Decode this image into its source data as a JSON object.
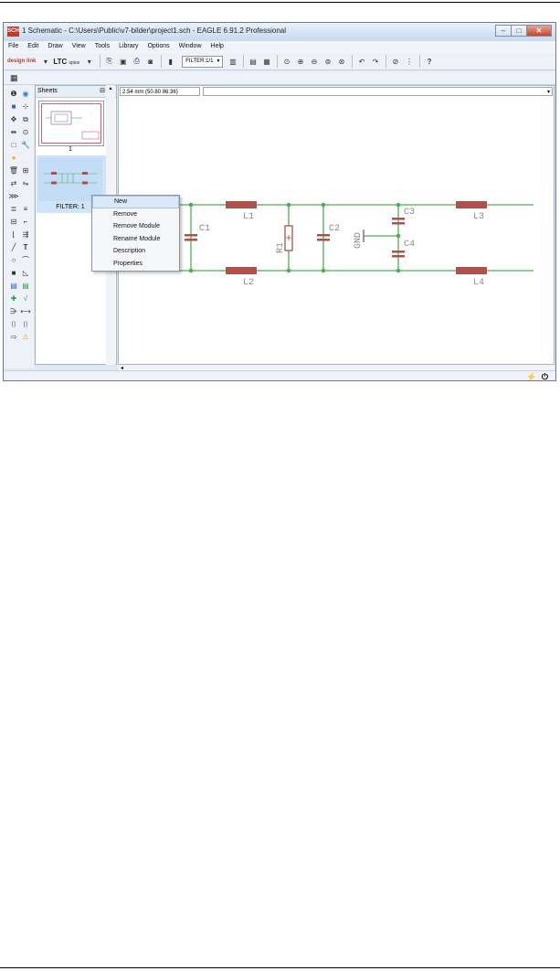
{
  "window": {
    "title": "1 Schematic - C:\\Users\\Public\\v7-bilder\\project1.sch - EAGLE 6.91.2 Professional",
    "app_icon_text": "SCH",
    "controls": [
      "–",
      "□",
      "✕"
    ]
  },
  "menu": [
    "File",
    "Edit",
    "Draw",
    "View",
    "Tools",
    "Library",
    "Options",
    "Window",
    "Help"
  ],
  "toolbar": {
    "design_link_label": "design link",
    "ltc_spice_label": "LTC",
    "ltc_spice_sub": "spice",
    "sheet_select": "FILTER:1/1"
  },
  "sheets_panel": {
    "title": "Sheets",
    "pin_glyph": "⊟",
    "close_glyph": "✕",
    "items": [
      {
        "label": "1"
      },
      {
        "label": "FILTER: 1"
      }
    ]
  },
  "coordinate_display": "2.54 mm (50.80 86.36)",
  "context_menu": {
    "items": [
      "New",
      "Remove",
      "Remove Module",
      "Rename Module",
      "Description",
      "Properties"
    ]
  },
  "schematic": {
    "labels": {
      "C1": "C1",
      "C2": "C2",
      "C3": "C3",
      "C4": "C4",
      "L1": "L1",
      "L2": "L2",
      "L3": "L3",
      "L4": "L4",
      "R1": "R1",
      "GND": "GND"
    },
    "colors": {
      "wire": "#4caf50",
      "part": "#b0504d",
      "label": "#8a8a8a"
    }
  }
}
